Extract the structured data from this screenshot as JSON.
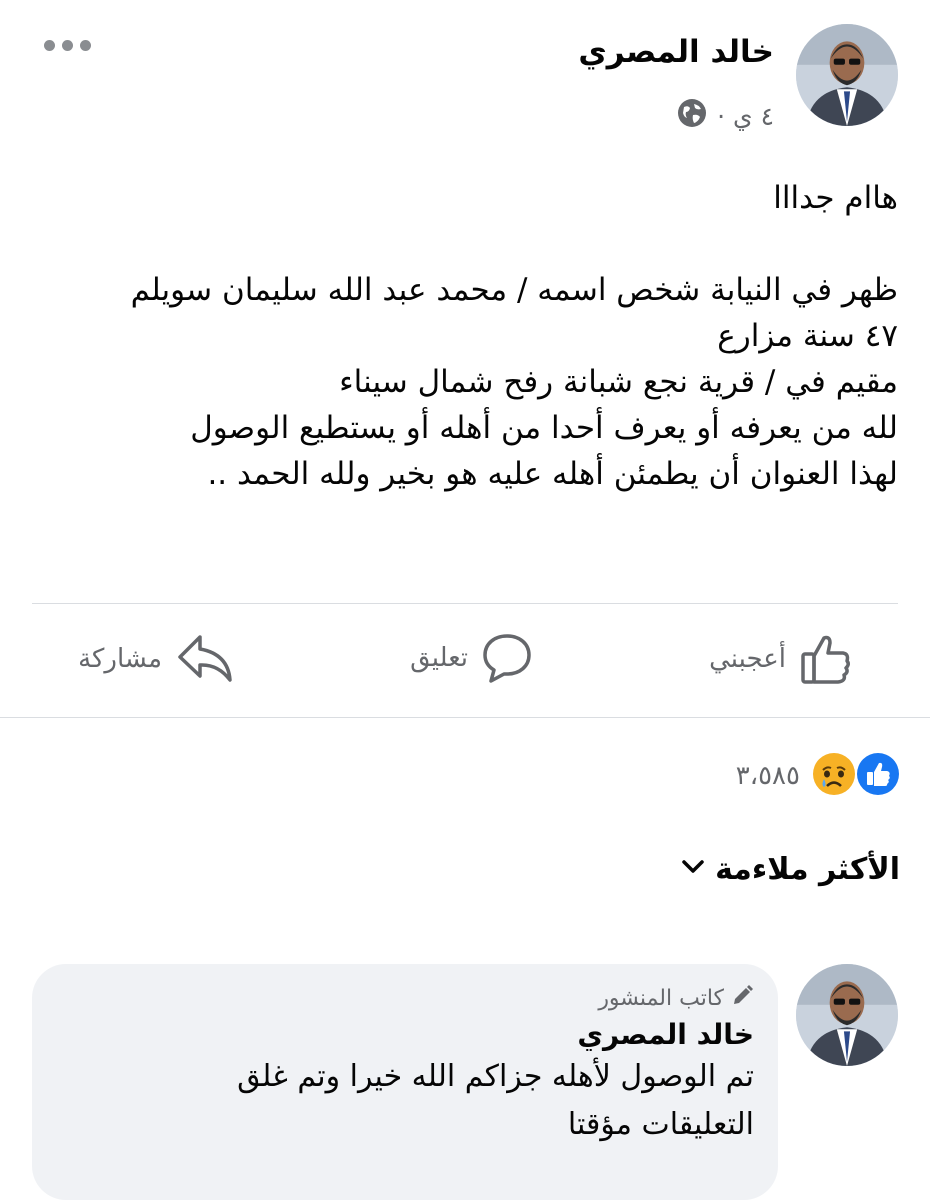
{
  "post": {
    "author": "خالد المصري",
    "time": "٤ ي ·",
    "privacy_icon": "globe-icon",
    "body": "هاام جدااا\n\nظهر في النيابة شخص اسمه / محمد عبد الله سليمان سويلم\n٤٧ سنة مزارع\n مقيم في /  قرية نجع شبانة رفح شمال سيناء\nلله من يعرفه أو يعرف أحدا من أهله أو يستطيع الوصول\nلهذا العنوان أن يطمئن أهله عليه هو بخير ولله الحمد .."
  },
  "actions": {
    "like": "أعجبني",
    "comment": "تعليق",
    "share": "مشاركة"
  },
  "reactions": {
    "count": "٣،٥٨٥",
    "types": [
      "like-icon",
      "sad-icon"
    ],
    "colors": {
      "like": "#1877f2",
      "sad": "#f7b125"
    }
  },
  "sort": {
    "label": "الأكثر ملاءمة"
  },
  "comment": {
    "badge": "كاتب المنشور",
    "author": "خالد المصري",
    "text": "تم الوصول لأهله جزاكم الله خيرا وتم غلق\nالتعليقات مؤقتا"
  }
}
